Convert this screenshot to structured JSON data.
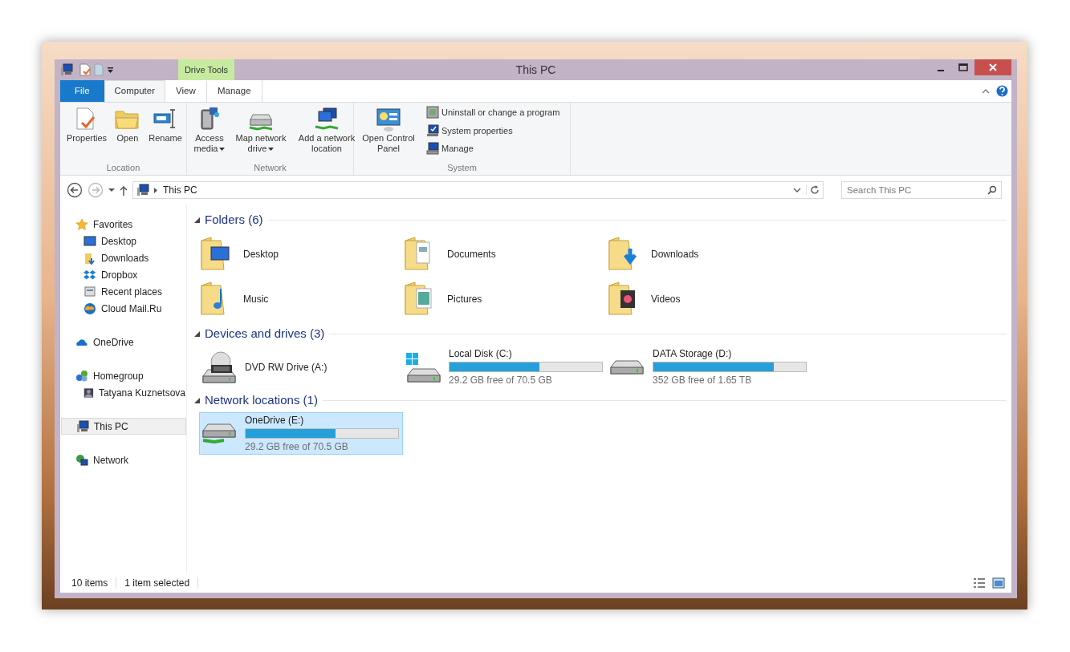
{
  "window": {
    "title": "This PC"
  },
  "context_tab_group": {
    "label": "Drive Tools"
  },
  "ribbon_tabs": [
    {
      "label": "File",
      "kind": "file",
      "selected": false
    },
    {
      "label": "Computer",
      "kind": "tab",
      "selected": true
    },
    {
      "label": "View",
      "kind": "tab",
      "selected": false
    },
    {
      "label": "Manage",
      "kind": "context",
      "selected": false
    }
  ],
  "ribbon_groups": [
    {
      "label": "Location",
      "buttons": [
        {
          "label": "Properties",
          "dropdown": false
        },
        {
          "label": "Open",
          "dropdown": false
        },
        {
          "label": "Rename",
          "dropdown": false
        }
      ]
    },
    {
      "label": "Network",
      "buttons": [
        {
          "label": "Access media",
          "dropdown": true
        },
        {
          "label": "Map network drive",
          "dropdown": true
        },
        {
          "label": "Add a network location",
          "dropdown": false
        }
      ]
    },
    {
      "label": "System",
      "buttons": [
        {
          "label": "Open Control Panel",
          "dropdown": false
        }
      ],
      "small_buttons": [
        {
          "label": "Uninstall or change a program"
        },
        {
          "label": "System properties"
        },
        {
          "label": "Manage"
        }
      ]
    }
  ],
  "address_bar": {
    "path": "This PC"
  },
  "search": {
    "placeholder": "Search This PC"
  },
  "navigation": [
    {
      "label": "Favorites",
      "selected": false,
      "children": [
        {
          "label": "Desktop",
          "selected": false
        },
        {
          "label": "Downloads",
          "selected": false
        },
        {
          "label": "Dropbox",
          "selected": false
        },
        {
          "label": "Recent places",
          "selected": false
        },
        {
          "label": "Cloud Mail.Ru",
          "selected": false
        }
      ]
    },
    {
      "label": "OneDrive",
      "selected": false
    },
    {
      "label": "Homegroup",
      "selected": false,
      "children": [
        {
          "label": "Tatyana Kuznetsova",
          "selected": false
        }
      ]
    },
    {
      "label": "This PC",
      "selected": true
    },
    {
      "label": "Network",
      "selected": false
    }
  ],
  "sections": [
    {
      "title": "Folders (6)",
      "kind": "folders",
      "items": [
        {
          "name": "Desktop",
          "selected": false
        },
        {
          "name": "Documents",
          "selected": false
        },
        {
          "name": "Downloads",
          "selected": false
        },
        {
          "name": "Music",
          "selected": false
        },
        {
          "name": "Pictures",
          "selected": false
        },
        {
          "name": "Videos",
          "selected": false
        }
      ]
    },
    {
      "title": "Devices and drives (3)",
      "kind": "drives",
      "items": [
        {
          "name": "DVD RW Drive (A:)",
          "selected": false
        },
        {
          "name": "Local Disk (C:)",
          "level": 0.59,
          "free": "29.2 GB free of 70.5 GB",
          "selected": false
        },
        {
          "name": "DATA Storage (D:)",
          "level": 0.79,
          "free": "352 GB free of 1.65 TB",
          "selected": false
        }
      ]
    },
    {
      "title": "Network locations (1)",
      "kind": "drives",
      "items": [
        {
          "name": "OneDrive (E:)",
          "level": 0.59,
          "free": "29.2 GB free of 70.5 GB",
          "selected": true
        }
      ]
    }
  ],
  "status_bar": {
    "count": "10 items",
    "selection": "1 item selected"
  }
}
